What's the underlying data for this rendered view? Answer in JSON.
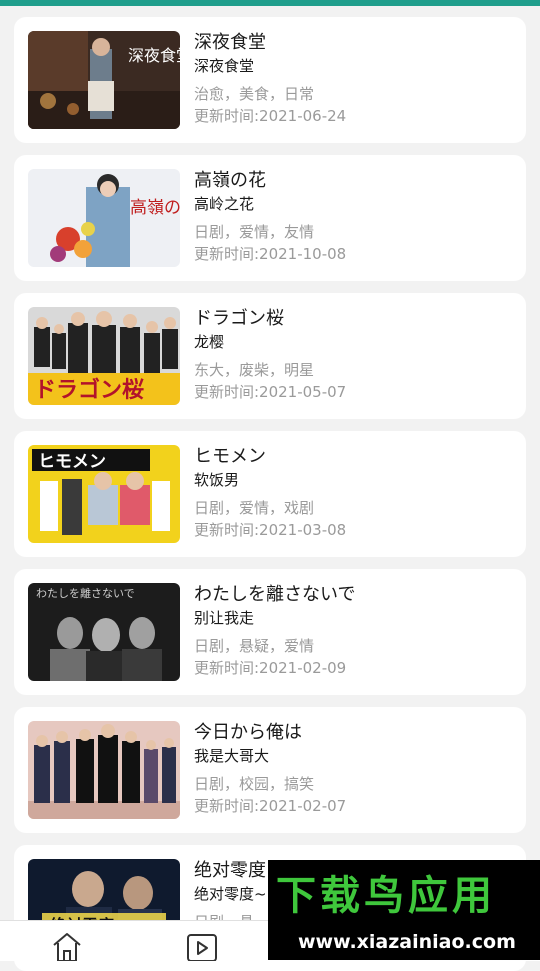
{
  "shows": [
    {
      "title": "深夜食堂",
      "subtitle": "深夜食堂",
      "tags": "治愈，美食，日常",
      "updated": "更新时间:2021-06-24",
      "poster_icon": "poster-shinya-shokudo",
      "poster_text": "深夜食堂"
    },
    {
      "title": "高嶺の花",
      "subtitle": "高岭之花",
      "tags": "日剧，爱情，友情",
      "updated": "更新时间:2021-10-08",
      "poster_icon": "poster-takane-no-hana",
      "poster_text": "高嶺の花"
    },
    {
      "title": "ドラゴン桜",
      "subtitle": "龙樱",
      "tags": "东大，废柴，明星",
      "updated": "更新时间:2021-05-07",
      "poster_icon": "poster-dragon-zakura",
      "poster_text": "ドラゴン桜"
    },
    {
      "title": "ヒモメン",
      "subtitle": "软饭男",
      "tags": "日剧，爱情，戏剧",
      "updated": "更新时间:2021-03-08",
      "poster_icon": "poster-himomen",
      "poster_text": "ヒモメン"
    },
    {
      "title": "わたしを離さないで",
      "subtitle": "别让我走",
      "tags": "日剧，悬疑，爱情",
      "updated": "更新时间:2021-02-09",
      "poster_icon": "poster-never-let-me-go",
      "poster_text": "わたしを離さないで"
    },
    {
      "title": "今日から俺は",
      "subtitle": "我是大哥大",
      "tags": "日剧，校园，搞笑",
      "updated": "更新时间:2021-02-07",
      "poster_icon": "poster-kyou-kara-ore-wa",
      "poster_text": ""
    },
    {
      "title": "绝对零度",
      "subtitle": "绝对零度~",
      "tags": "日剧，悬",
      "updated": "",
      "poster_icon": "poster-zettai-reido",
      "poster_text": "絶対零度"
    }
  ],
  "bottom_nav": {
    "home_icon": "home-icon",
    "play_icon": "play-icon"
  },
  "watermark": {
    "cn_text": "下载鸟应用",
    "url_text": "www.xiazainiao.com"
  },
  "colors": {
    "accent": "#1f9e8c",
    "watermark_green": "#3fc73c"
  }
}
